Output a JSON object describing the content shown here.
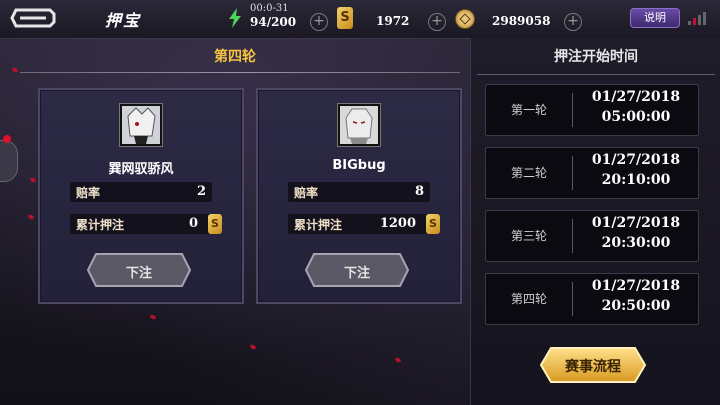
{
  "header": {
    "title": "押宝",
    "energy_timer": "00:0-31",
    "energy": "94/200",
    "gold_symbol": "S",
    "gold": "1972",
    "coins": "2989058",
    "help_label": "说明"
  },
  "round": {
    "title": "第四轮"
  },
  "players": [
    {
      "name": "巽网驭骄风",
      "odds_label": "赔率",
      "odds": "2",
      "total_label": "累计押注",
      "total": "0",
      "bet_label": "下注"
    },
    {
      "name": "BIGbug",
      "odds_label": "赔率",
      "odds": "8",
      "total_label": "累计押注",
      "total": "1200",
      "bet_label": "下注"
    }
  ],
  "schedule": {
    "title": "押注开始时间",
    "rounds": [
      {
        "label": "第一轮",
        "date": "01/27/2018",
        "time": "05:00:00"
      },
      {
        "label": "第二轮",
        "date": "01/27/2018",
        "time": "20:10:00"
      },
      {
        "label": "第三轮",
        "date": "01/27/2018",
        "time": "20:30:00"
      },
      {
        "label": "第四轮",
        "date": "01/27/2018",
        "time": "20:50:00"
      }
    ],
    "flow_button": "赛事流程"
  },
  "colors": {
    "accent_gold": "#f5c243",
    "panel_bg": "#23213a",
    "button_gold": "#e8b43a"
  }
}
